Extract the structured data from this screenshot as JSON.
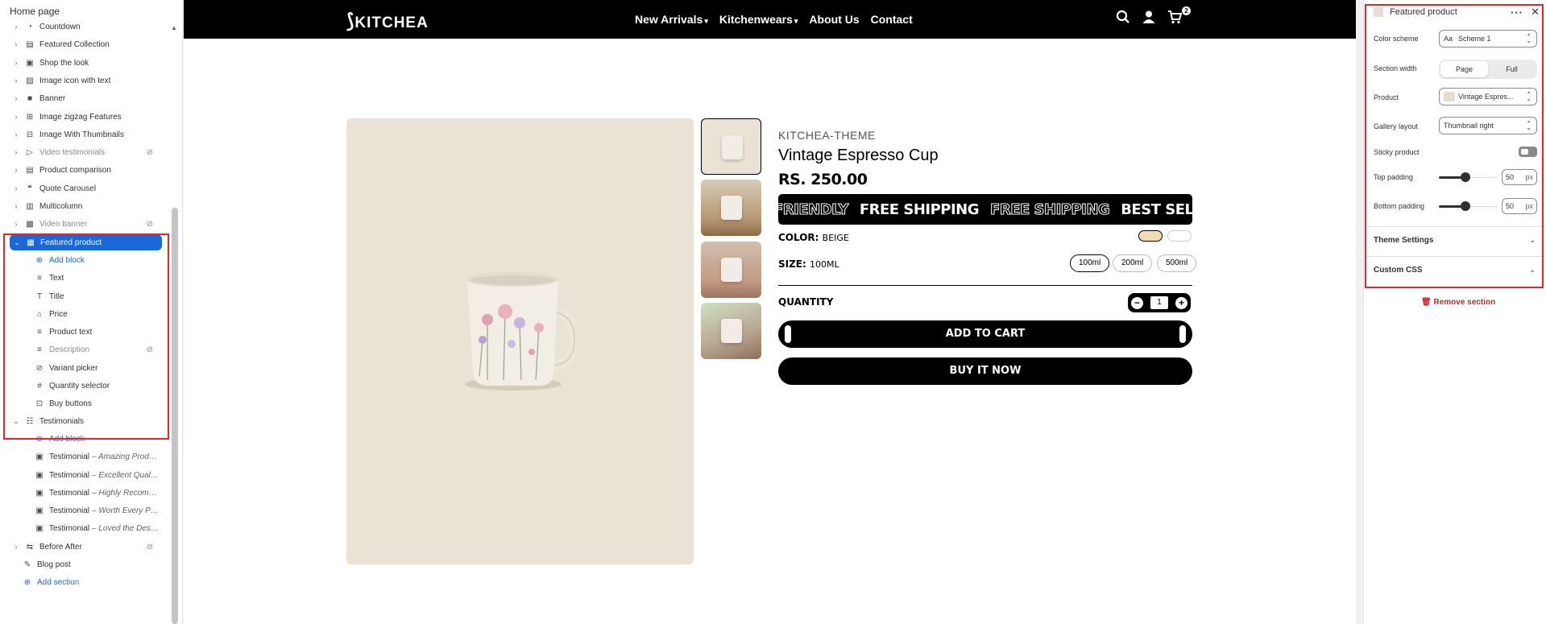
{
  "left_panel": {
    "title": "Home page",
    "sections": [
      {
        "label": "Countdown",
        "icon": "countdown-icon",
        "glyph": "◔"
      },
      {
        "label": "Featured Collection",
        "icon": "collection-icon",
        "glyph": "▤"
      },
      {
        "label": "Shop the look",
        "icon": "image-icon",
        "glyph": "▣"
      },
      {
        "label": "Image icon with text",
        "icon": "image-icon",
        "glyph": "▨"
      },
      {
        "label": "Banner",
        "icon": "banner-icon",
        "glyph": "■"
      },
      {
        "label": "Image zigzag Features",
        "icon": "image-zigzag-icon",
        "glyph": "⊞"
      },
      {
        "label": "Image With Thumbnails",
        "icon": "image-thumbnails-icon",
        "glyph": "⊟"
      },
      {
        "label": "Video testimonials",
        "icon": "video-icon",
        "glyph": "▷"
      },
      {
        "label": "Product comparison",
        "icon": "table-icon",
        "glyph": "▤"
      },
      {
        "label": "Quote Carousel",
        "icon": "quote-icon",
        "glyph": "❝"
      },
      {
        "label": "Multicolumn",
        "icon": "columns-icon",
        "glyph": "▥"
      },
      {
        "label": "Video banner",
        "icon": "video-banner-icon",
        "glyph": "▩"
      },
      {
        "label": "Featured product",
        "icon": "product-icon",
        "glyph": "▦"
      }
    ],
    "featured_blocks": {
      "add_block": "Add block",
      "items": [
        {
          "label": "Text",
          "icon": "text-icon",
          "glyph": "≡"
        },
        {
          "label": "Title",
          "icon": "title-icon",
          "glyph": "T"
        },
        {
          "label": "Price",
          "icon": "price-tag-icon",
          "glyph": "⌂"
        },
        {
          "label": "Product text",
          "icon": "text-icon",
          "glyph": "≡"
        },
        {
          "label": "Description",
          "icon": "text-icon",
          "glyph": "≡"
        },
        {
          "label": "Variant picker",
          "icon": "variant-icon",
          "glyph": "⊘"
        },
        {
          "label": "Quantity selector",
          "icon": "hash-icon",
          "glyph": "#"
        },
        {
          "label": "Buy buttons",
          "icon": "cursor-icon",
          "glyph": "⊡"
        }
      ]
    },
    "testimonials": {
      "label": "Testimonials",
      "add_block": "Add block",
      "items": [
        {
          "label": "Testimonial",
          "sub": "– Amazing Product!"
        },
        {
          "label": "Testimonial",
          "sub": "– Excellent Quality!"
        },
        {
          "label": "Testimonial",
          "sub": "– Highly Recomme..."
        },
        {
          "label": "Testimonial",
          "sub": "– Worth Every Pen..."
        },
        {
          "label": "Testimonial",
          "sub": "– Loved the Design!"
        }
      ]
    },
    "after_sections": [
      {
        "label": "Before After",
        "icon": "before-after-icon",
        "glyph": "⇆"
      },
      {
        "label": "Blog post",
        "icon": "edit-icon",
        "glyph": "✎"
      }
    ],
    "add_section": "Add section"
  },
  "preview": {
    "logo": "KITCHEA",
    "menu": [
      {
        "label": "New Arrivals",
        "has_dropdown": true
      },
      {
        "label": "Kitchenwears",
        "has_dropdown": true
      },
      {
        "label": "About Us",
        "has_dropdown": false
      },
      {
        "label": "Contact",
        "has_dropdown": false
      }
    ],
    "cart_count": "2",
    "product": {
      "vendor": "KITCHEA-THEME",
      "title": "Vintage Espresso Cup",
      "price": "RS. 250.00",
      "marquee": [
        "FRIENDLY",
        "FREE SHIPPING",
        "FREE SHIPPING",
        "BEST SELLER",
        "BES"
      ],
      "color_label": "COLOR",
      "color_value": "BEIGE",
      "color_swatches": [
        "#efdcb2",
        "#ffffff"
      ],
      "size_label": "SIZE",
      "size_value": "100ML",
      "sizes": [
        "100ml",
        "200ml",
        "500ml"
      ],
      "quantity_label": "QUANTITY",
      "quantity": "1",
      "add_to_cart": "ADD TO CART",
      "buy_now": "BUY IT NOW"
    }
  },
  "right_panel": {
    "title": "Featured product",
    "color_scheme_label": "Color scheme",
    "color_scheme_value": "Scheme 1",
    "section_width_label": "Section width",
    "section_width_options": [
      "Page",
      "Full"
    ],
    "product_label": "Product",
    "product_value": "Vintage Espres...",
    "gallery_layout_label": "Gallery layout",
    "gallery_layout_value": "Thumbnail right",
    "sticky_label": "Sticky product",
    "top_padding_label": "Top padding",
    "top_padding_value": "50",
    "bottom_padding_label": "Bottom padding",
    "bottom_padding_value": "50",
    "unit": "px",
    "theme_settings": "Theme Settings",
    "custom_css": "Custom CSS",
    "remove_section": "Remove section"
  },
  "colors": {
    "selected_blue": "#1c67d6",
    "highlight_red": "#e0262f",
    "remove_red": "#c5262f"
  }
}
